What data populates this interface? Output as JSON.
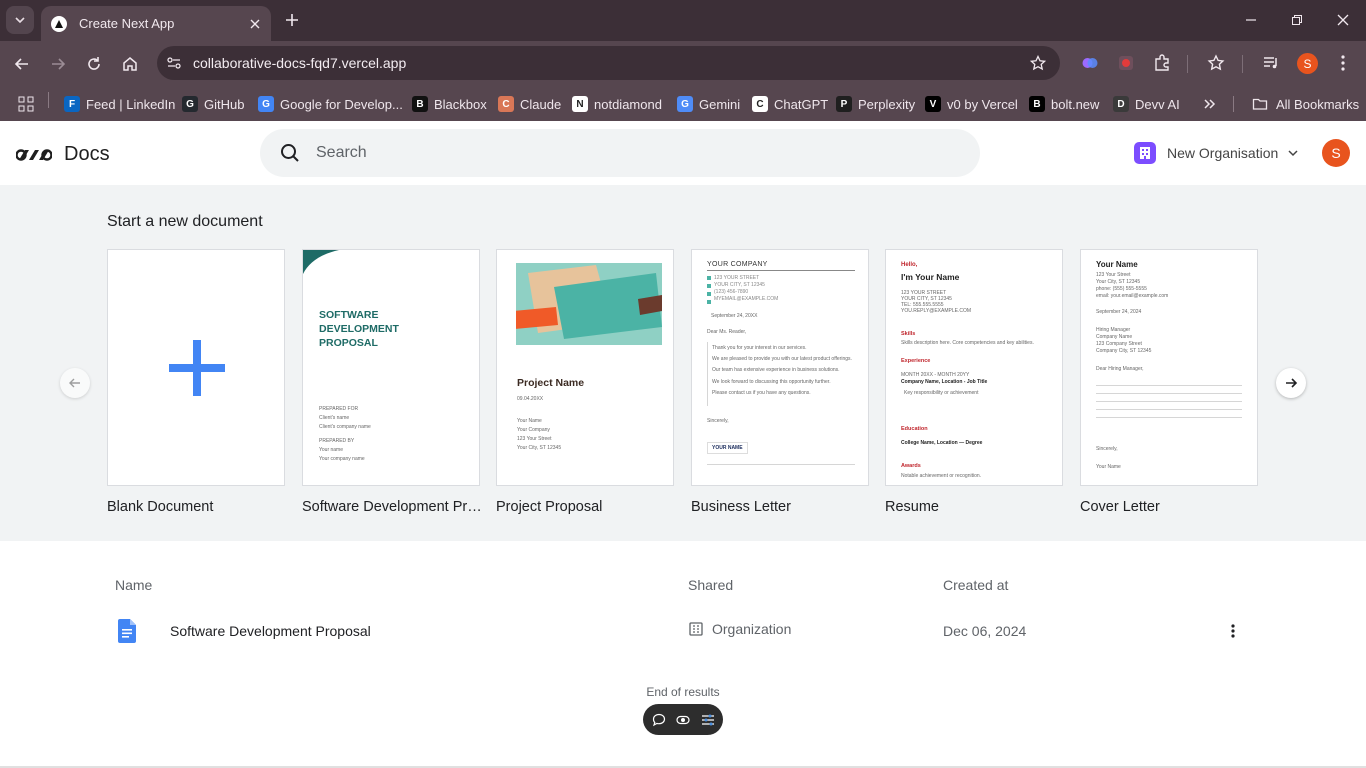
{
  "browser": {
    "tab_title": "Create Next App",
    "url": "collaborative-docs-fqd7.vercel.app",
    "profile_initial": "S",
    "bookmarks": [
      {
        "label": "Feed | LinkedIn",
        "icon": "linkedin-icon",
        "color": "#0a66c2"
      },
      {
        "label": "GitHub",
        "icon": "github-icon",
        "color": "#24292f"
      },
      {
        "label": "Google for Develop...",
        "icon": "google-icon",
        "color": "#4285f4"
      },
      {
        "label": "Blackbox",
        "icon": "blackbox-icon",
        "color": "#111111"
      },
      {
        "label": "Claude",
        "icon": "claude-icon",
        "color": "#d97757"
      },
      {
        "label": "notdiamond",
        "icon": "notdiamond-icon",
        "color": "#ffffff"
      },
      {
        "label": "Gemini",
        "icon": "gemini-icon",
        "color": "#4f8cf7"
      },
      {
        "label": "ChatGPT",
        "icon": "chatgpt-icon",
        "color": "#ffffff"
      },
      {
        "label": "Perplexity",
        "icon": "perplexity-icon",
        "color": "#1f1f1f"
      },
      {
        "label": "v0 by Vercel",
        "icon": "v0-icon",
        "color": "#000000"
      },
      {
        "label": "bolt.new",
        "icon": "bolt-icon",
        "color": "#000000"
      },
      {
        "label": "Devv AI",
        "icon": "devv-icon",
        "color": "#3a3a3a"
      }
    ],
    "all_bookmarks": "All Bookmarks"
  },
  "app": {
    "logo_text": "Docs",
    "search_placeholder": "Search",
    "organisation": "New Organisation",
    "user_initial": "S",
    "accent": "#4285f4"
  },
  "templates": {
    "section_title": "Start a new document",
    "items": [
      {
        "label": "Blank Document"
      },
      {
        "label": "Software Development Proposal",
        "thumb": {
          "title": "SOFTWARE\nDEVELOPMENT\nPROPOSAL",
          "prepared_for": "PREPARED FOR",
          "client_name": "Client's name",
          "client_company": "Client's company name",
          "prepared_by": "PREPARED BY",
          "your_name": "Your name",
          "your_company": "Your company name"
        }
      },
      {
        "label": "Project Proposal",
        "thumb": {
          "title": "Project Name",
          "date": "09.04.20XX",
          "lines": [
            "Your Name",
            "Your Company",
            "123 Your Street",
            "Your City, ST 12345"
          ]
        }
      },
      {
        "label": "Business Letter",
        "thumb": {
          "company": "YOUR COMPANY",
          "address": [
            "123 YOUR STREET",
            "YOUR CITY, ST 12345",
            "(123) 456-7890",
            "MYEMAIL@EXAMPLE.COM"
          ],
          "date": "September 24, 20XX",
          "greeting": "Dear Ms. Reader,",
          "body": [
            "Thank you for your interest in our services.",
            "We are pleased to provide you with our latest product offerings.",
            "Our team has extensive experience in business solutions.",
            "We look forward to discussing this opportunity further.",
            "Please contact us if you have any questions."
          ],
          "closing": "Sincerely,",
          "signature": "YOUR NAME"
        }
      },
      {
        "label": "Resume",
        "thumb": {
          "hello": "Hello,",
          "name": "I'm Your Name",
          "contact": [
            "123 YOUR STREET",
            "YOUR CITY, ST 12345",
            "TEL: 555.555.5555",
            "YOU.REPLY@EXAMPLE.COM"
          ],
          "skills_h": "Skills",
          "skills": "Skills description here. Core competencies and key abilities.",
          "experience_h": "Experience",
          "exp_dates": "MONTH 20XX - MONTH 20YY",
          "exp_role": "Company Name, Location - Job Title",
          "exp_bullet": "Key responsibility or achievement",
          "education_h": "Education",
          "education": "College Name, Location — Degree",
          "awards_h": "Awards",
          "awards": "Notable achievement or recognition."
        }
      },
      {
        "label": "Cover Letter",
        "thumb": {
          "name": "Your Name",
          "contact": [
            "123 Your Street",
            "Your City, ST 12345",
            "phone: (555) 555-5555",
            "email: your.email@example.com"
          ],
          "date": "September 24, 2024",
          "recipient": [
            "Hiring Manager",
            "Company Name",
            "123 Company Street",
            "Company City, ST 12345"
          ],
          "greeting": "Dear Hiring Manager,",
          "closing": "Sincerely,",
          "signature": "Your Name"
        }
      }
    ]
  },
  "documents": {
    "headers": {
      "name": "Name",
      "shared": "Shared",
      "created": "Created at"
    },
    "rows": [
      {
        "name": "Software Development Proposal",
        "shared": "Organization",
        "created": "Dec 06, 2024"
      }
    ],
    "end_text": "End of results"
  }
}
